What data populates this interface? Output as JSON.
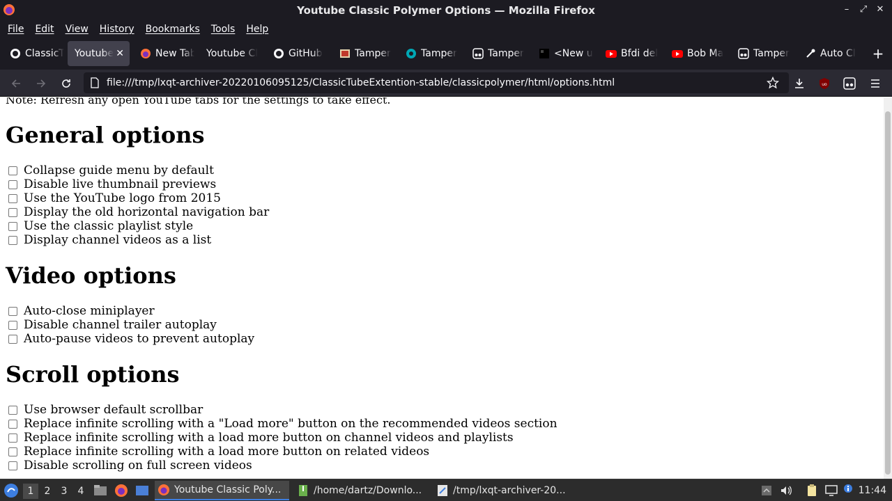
{
  "window": {
    "title": "Youtube Classic Polymer Options — Mozilla Firefox"
  },
  "menubar": {
    "items": [
      "File",
      "Edit",
      "View",
      "History",
      "Bookmarks",
      "Tools",
      "Help"
    ]
  },
  "tabs": [
    {
      "label": "ClassicT",
      "icon": "github-icon"
    },
    {
      "label": "Youtube",
      "icon": "none",
      "active": true
    },
    {
      "label": "New Tab",
      "icon": "firefox-icon"
    },
    {
      "label": "Youtube Cl",
      "icon": "none"
    },
    {
      "label": "GitHub",
      "icon": "github-icon"
    },
    {
      "label": "Tamper",
      "icon": "image-icon"
    },
    {
      "label": "Tamper",
      "icon": "tampermonkey-icon"
    },
    {
      "label": "Tamper",
      "icon": "tampermonkey-icon"
    },
    {
      "label": "<New u",
      "icon": "page-icon"
    },
    {
      "label": "Bfdi del",
      "icon": "youtube-icon"
    },
    {
      "label": "Bob Ma",
      "icon": "youtube-icon"
    },
    {
      "label": "Tamper",
      "icon": "tampermonkey-icon"
    },
    {
      "label": "Auto Cl",
      "icon": "tool-icon"
    }
  ],
  "navbar": {
    "url": "file:///tmp/lxqt-archiver-20220106095125/ClassicTubeExtention-stable/classicpolymer/html/options.html"
  },
  "page": {
    "note": "Note: Refresh any open YouTube tabs for the settings to take effect.",
    "sections": [
      {
        "heading": "General options",
        "options": [
          "Collapse guide menu by default",
          "Disable live thumbnail previews",
          "Use the YouTube logo from 2015",
          "Display the old horizontal navigation bar",
          "Use the classic playlist style",
          "Display channel videos as a list"
        ]
      },
      {
        "heading": "Video options",
        "options": [
          "Auto-close miniplayer",
          "Disable channel trailer autoplay",
          "Auto-pause videos to prevent autoplay"
        ]
      },
      {
        "heading": "Scroll options",
        "options": [
          "Use browser default scrollbar",
          "Replace infinite scrolling with a \"Load more\" button on the recommended videos section",
          "Replace infinite scrolling with a load more button on channel videos and playlists",
          "Replace infinite scrolling with a load more button on related videos",
          "Disable scrolling on full screen videos"
        ]
      }
    ]
  },
  "taskbar": {
    "workspaces": [
      "1",
      "2",
      "3",
      "4"
    ],
    "tasks": [
      {
        "label": "Youtube Classic Poly...",
        "icon": "firefox-icon"
      },
      {
        "label": "/home/dartz/Downlo...",
        "icon": "archive-icon"
      },
      {
        "label": "/tmp/lxqt-archiver-20...",
        "icon": "editor-icon"
      }
    ],
    "clock": "11:44"
  },
  "colors": {
    "chrome_dark": "#1c1b22",
    "toolbar": "#2b2a33",
    "active_tab": "#42414d",
    "taskbar": "#2c2c2c",
    "youtube_red": "#ff0000",
    "ublock_red": "#800000"
  }
}
